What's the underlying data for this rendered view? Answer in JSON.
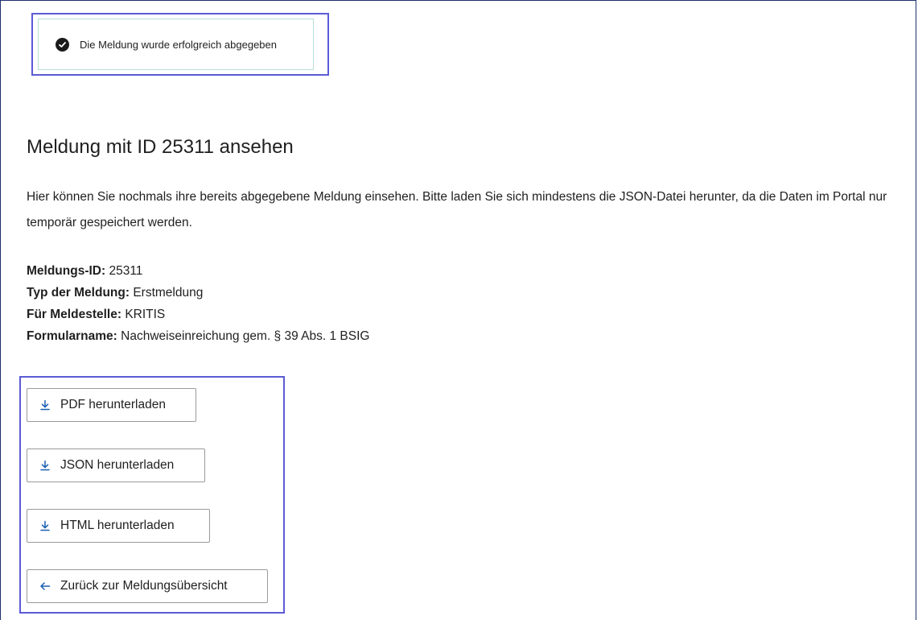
{
  "toast": {
    "message": "Die Meldung wurde erfolgreich abgegeben",
    "icon": "check-circle-icon"
  },
  "page": {
    "title": "Meldung mit ID 25311 ansehen",
    "intro": "Hier können Sie nochmals ihre bereits abgegebene Meldung einsehen. Bitte laden Sie sich mindestens die JSON-Datei herunter, da die Daten im Portal nur temporär gespeichert werden."
  },
  "meta": [
    {
      "label": "Meldungs-ID:",
      "value": "25311"
    },
    {
      "label": "Typ der Meldung:",
      "value": "Erstmeldung"
    },
    {
      "label": "Für Meldestelle:",
      "value": "KRITIS"
    },
    {
      "label": "Formularname:",
      "value": "Nachweiseinreichung gem. § 39 Abs. 1 BSIG"
    }
  ],
  "actions": {
    "pdf_label": "PDF herunterladen",
    "json_label": "JSON herunterladen",
    "html_label": "HTML herunterladen",
    "back_label": "Zurück zur Meldungsübersicht"
  },
  "colors": {
    "accent": "#1a5fb4",
    "highlight": "#5b5bd6",
    "frame": "#1f2f6b"
  }
}
